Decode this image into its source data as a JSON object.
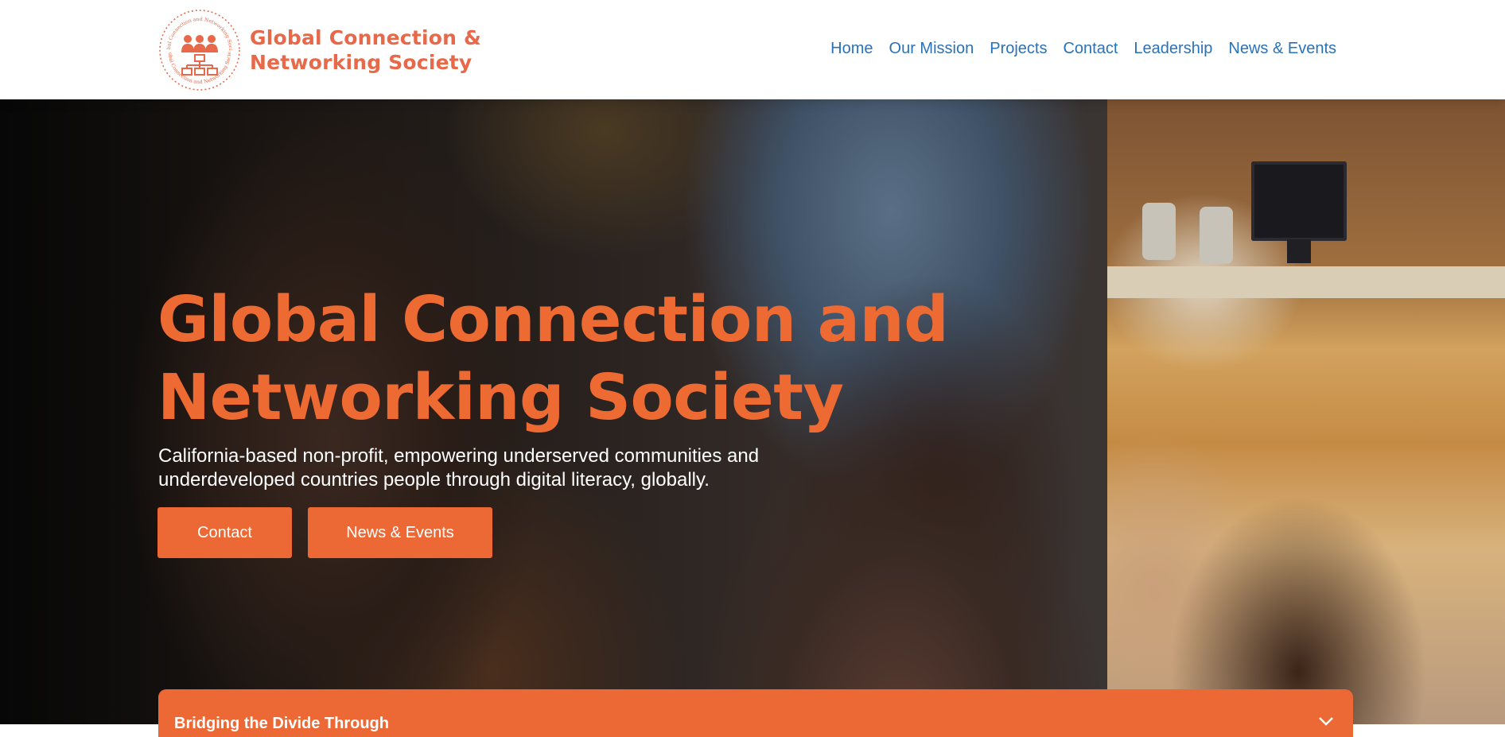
{
  "header": {
    "logo": {
      "line1": "Global Connection &",
      "line2": "Networking Society",
      "emblem_ring_text": "Global Connection and Networking Society",
      "color": "#e8694a"
    },
    "nav": [
      {
        "label": "Home"
      },
      {
        "label": "Our Mission"
      },
      {
        "label": "Projects"
      },
      {
        "label": "Contact"
      },
      {
        "label": "Leadership"
      },
      {
        "label": "News & Events"
      }
    ],
    "nav_color": "#2a72b8"
  },
  "hero": {
    "title_line1": "Global Connection and",
    "title_line2": "Networking Society",
    "subtitle_line1": "California-based non-profit, empowering underserved communities and",
    "subtitle_line2": "underdeveloped countries people through digital literacy, globally.",
    "buttons": {
      "contact": "Contact",
      "news": "News & Events"
    },
    "accent_color": "#ec6834"
  },
  "accordion": {
    "title": "Bridging the Divide Through",
    "icon": "chevron-down-icon"
  }
}
